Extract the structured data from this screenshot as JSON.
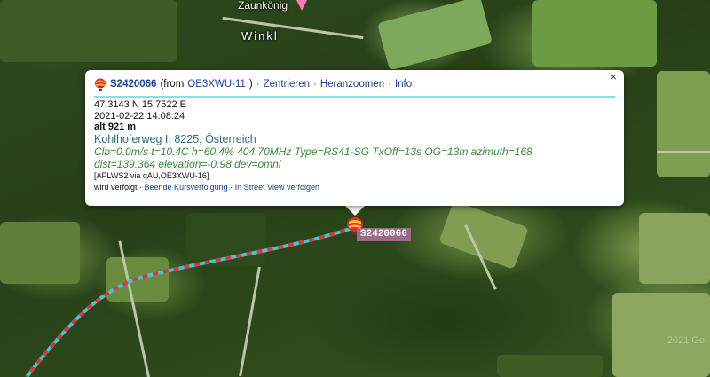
{
  "map": {
    "poi_name": "Zaunkönig",
    "place_name": "Winkl",
    "copyright": "2021 Go"
  },
  "popup": {
    "callsign": "S2420066",
    "from_prefix": "(from",
    "from_station": "OE3XWU-11",
    "from_suffix": ")",
    "separator": "·",
    "links": {
      "center": "Zentrieren",
      "zoom": "Heranzoomen",
      "info": "Info"
    },
    "coords": "47.3143 N 15.7522 E",
    "timestamp": "2021-02-22 14:08:24",
    "altitude": "alt 921 m",
    "address": "Kohlhoferweg I, 8225, Österreich",
    "comment_line1": "Clb=0.0m/s t=10.4C h=60.4% 404.70MHz Type=RS41-SG TxOff=13s OG=13m azimuth=168",
    "comment_line2": "dist=139.364 elevation=-0.98 dev=omni",
    "path": "[APLWS2 via qAU,OE3XWU-16]",
    "tracking_prefix": "wird verfolgt ·",
    "tracking_stop": "Beende Kursverfolgung",
    "tracking_streetview": "In Street View verfolgen",
    "close_symbol": "×"
  },
  "marker": {
    "label": "S2420066"
  },
  "colors": {
    "track_line": "#3fc6d6",
    "track_dash": "#d63a3a",
    "callsign_link": "#1a3f9c",
    "address_text": "#2f6f6f",
    "comment_text": "#3a8a3a",
    "rule": "#7fe3ec",
    "marker_label_bg": "#9c6a8d"
  },
  "icons": {
    "balloon": "hot-air-balloon-icon",
    "close": "close-icon",
    "poi": "pink-triangle-marker-icon"
  }
}
